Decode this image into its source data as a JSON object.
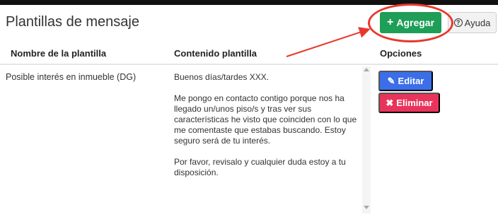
{
  "header": {
    "title": "Plantillas de mensaje",
    "add_label": "Agregar",
    "add_icon": "plus-icon",
    "help_label": "Ayuda",
    "help_icon": "question-circle-icon"
  },
  "table": {
    "columns": [
      "Nombre de la plantilla",
      "Contenido plantilla",
      "Opciones"
    ],
    "rows": [
      {
        "name": "Posible interés en inmueble (DG)",
        "content": [
          "Buenos días/tardes XXX.",
          "Me pongo en contacto contigo porque nos ha llegado un/unos piso/s y tras ver sus características he visto que coinciden con lo que me comentaste que estabas buscando. Estoy seguro será de tu interés.",
          "Por favor, revisalo y cualquier duda estoy a tu disposición."
        ],
        "edit_label": "Editar",
        "edit_icon": "edit-icon",
        "delete_label": "Eliminar",
        "delete_icon": "close-icon"
      }
    ]
  },
  "colors": {
    "add_button": "#1e9e56",
    "edit_button": "#3b6ee8",
    "delete_button": "#e8345a",
    "annotation": "#e8382e"
  }
}
